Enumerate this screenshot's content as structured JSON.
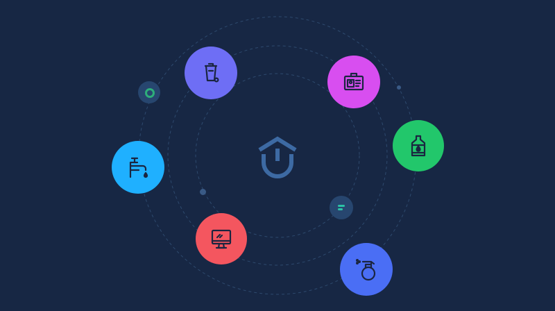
{
  "background": "#172744",
  "orbit_color": "#2e4a6e",
  "center_icon": {
    "name": "home-logo-icon",
    "color": "#3d6aa3"
  },
  "nodes": [
    {
      "name": "trash-can-icon",
      "color": "#6e6ef5",
      "icon_color": "#1a2540"
    },
    {
      "name": "id-card-icon",
      "color": "#d84ef0",
      "icon_color": "#1a2540"
    },
    {
      "name": "bottle-icon",
      "color": "#22c76b",
      "icon_color": "#1a2540"
    },
    {
      "name": "faucet-icon",
      "color": "#1fb0ff",
      "icon_color": "#1a2540"
    },
    {
      "name": "monitor-icon",
      "color": "#f4565f",
      "icon_color": "#1a2540"
    },
    {
      "name": "spray-bottle-icon",
      "color": "#4a6ef5",
      "icon_color": "#1a2540"
    }
  ],
  "accent_dots": [
    {
      "name": "green-ring-dot",
      "color": "#2eae7a"
    },
    {
      "name": "teal-lines-dot",
      "color": "#2cc2a6"
    }
  ]
}
